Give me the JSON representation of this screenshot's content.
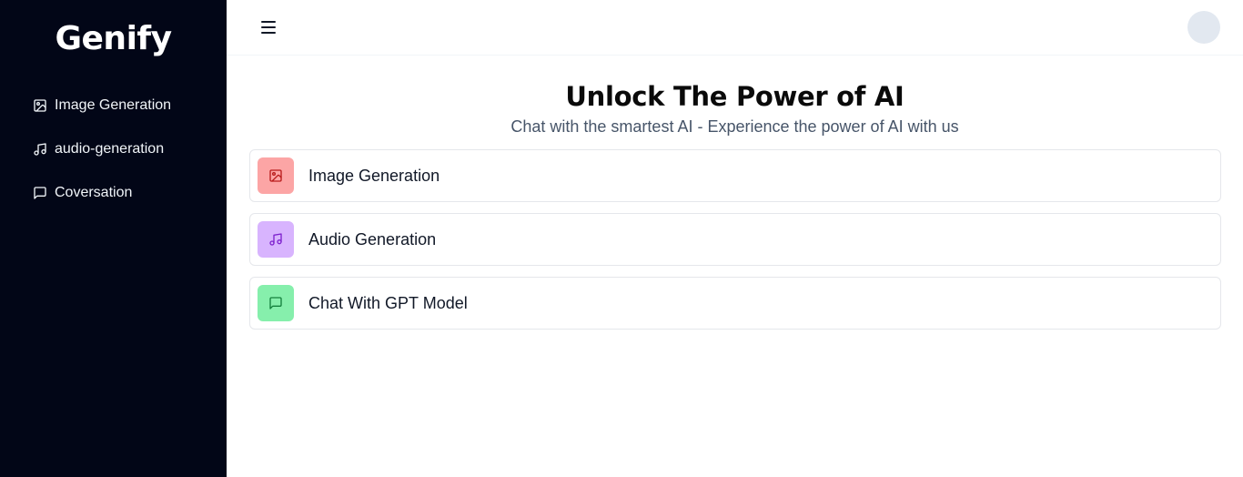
{
  "sidebar": {
    "brand": "Genify",
    "items": [
      {
        "label": "Image Generation",
        "icon": "image-icon"
      },
      {
        "label": "audio-generation",
        "icon": "music-icon"
      },
      {
        "label": "Coversation",
        "icon": "message-icon"
      }
    ]
  },
  "header": {
    "menu_icon": "hamburger-menu-icon",
    "avatar": "user-avatar"
  },
  "hero": {
    "title": "Unlock The Power of AI",
    "subtitle": "Chat with the smartest AI - Experience the power of AI with us"
  },
  "cards": [
    {
      "label": "Image Generation",
      "icon": "image-icon",
      "bg": "#fca5a5",
      "fg": "#b91c1c"
    },
    {
      "label": "Audio Generation",
      "icon": "music-icon",
      "bg": "#d8b4fe",
      "fg": "#7e22ce"
    },
    {
      "label": "Chat With GPT Model",
      "icon": "message-icon",
      "bg": "#86efac",
      "fg": "#15803d"
    }
  ],
  "colors": {
    "sidebar_bg": "#020617",
    "text_primary": "#111827",
    "text_muted": "#475569"
  }
}
